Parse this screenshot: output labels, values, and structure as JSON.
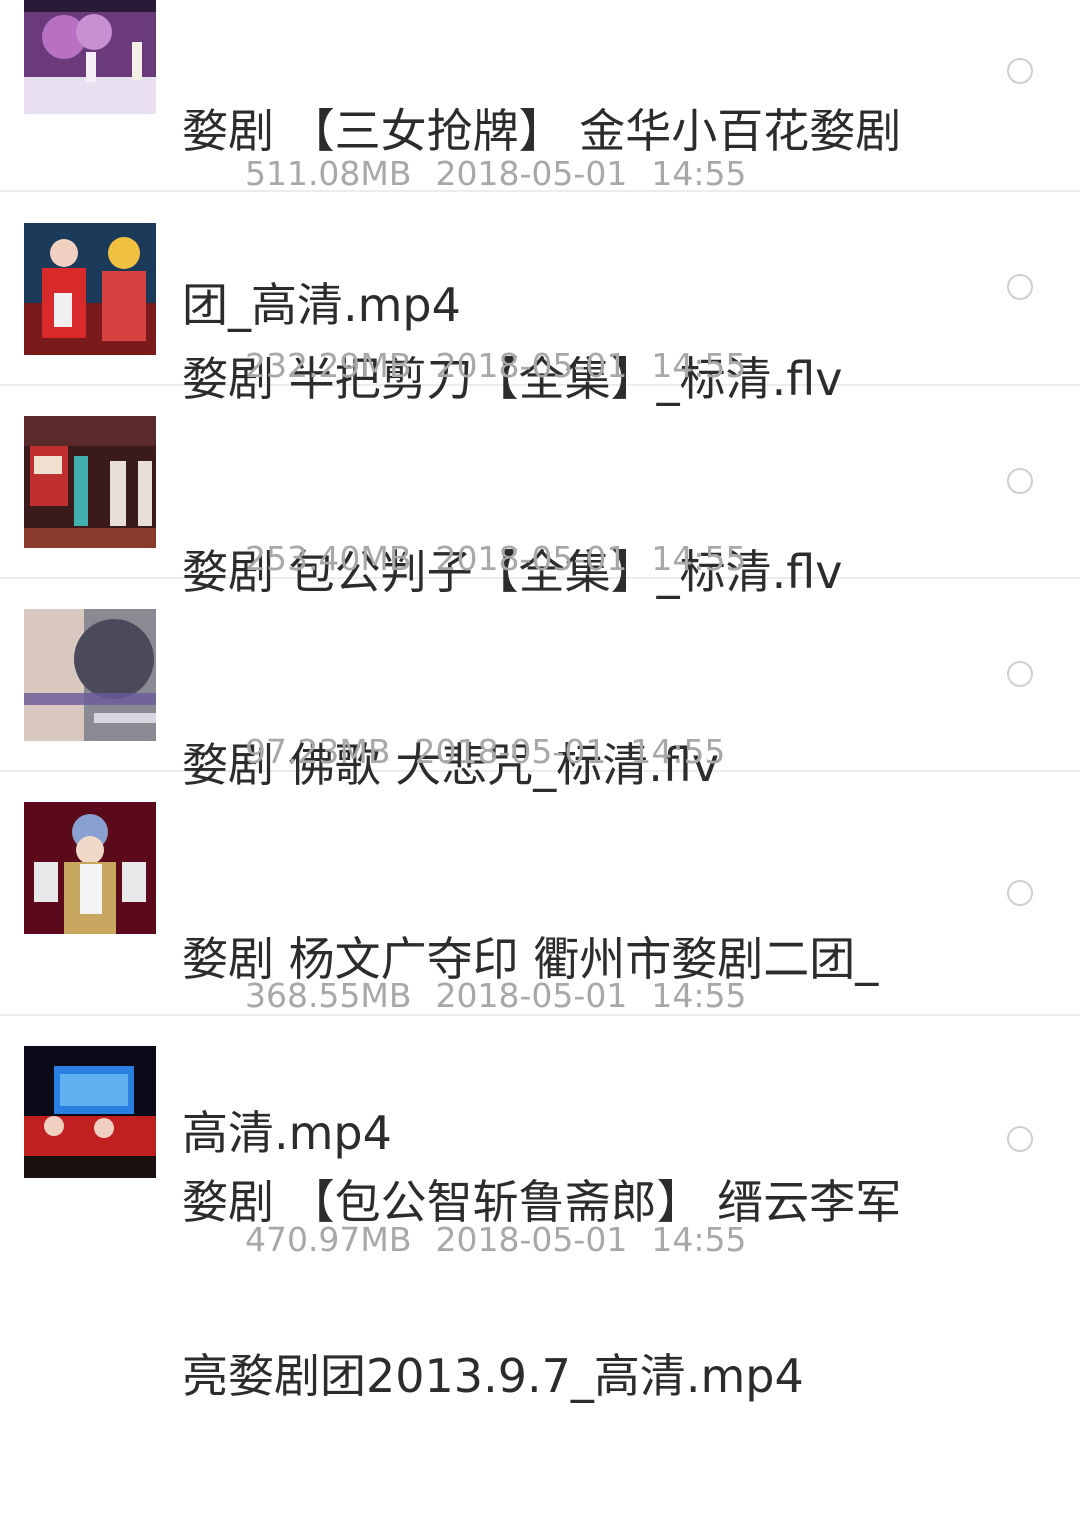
{
  "files": [
    {
      "title_line1": "婺剧 【三女抢牌】 金华小百花婺剧",
      "title_line2": "团_高清.mp4",
      "size": "511.08MB",
      "date": "2018-05-01",
      "time": "14:55"
    },
    {
      "title_line1": "婺剧 半把剪刀【全集】_标清.flv",
      "title_line2": "",
      "size": "232.29MB",
      "date": "2018-05-01",
      "time": "14:55"
    },
    {
      "title_line1": "婺剧 包公判子【全集】_标清.flv",
      "title_line2": "",
      "size": "253.40MB",
      "date": "2018-05-01",
      "time": "14:55"
    },
    {
      "title_line1": "婺剧 佛歌 大悲咒_标清.flv",
      "title_line2": "",
      "size": "97.23MB",
      "date": "2018-05-01",
      "time": "14:55"
    },
    {
      "title_line1": "婺剧 杨文广夺印 衢州市婺剧二团_",
      "title_line2": "高清.mp4",
      "size": "368.55MB",
      "date": "2018-05-01",
      "time": "14:55"
    },
    {
      "title_line1": "婺剧 【包公智斩鲁斋郎】 缙云李军",
      "title_line2": "亮婺剧团2013.9.7_高清.mp4",
      "size": "470.97MB",
      "date": "2018-05-01",
      "time": "14:55"
    }
  ]
}
